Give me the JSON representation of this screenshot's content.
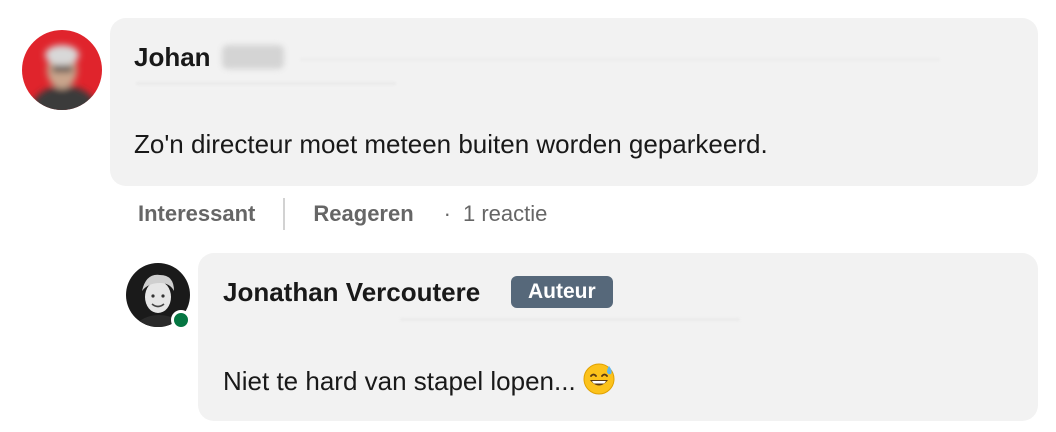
{
  "comment": {
    "author_first_name": "Johan",
    "text": "Zo'n directeur moet meteen buiten worden geparkeerd."
  },
  "actions": {
    "interesting_label": "Interessant",
    "reply_label": "Reageren",
    "separator_dot": "·",
    "reply_count": "1 reactie"
  },
  "reply": {
    "author_name": "Jonathan Vercoutere",
    "author_badge": "Auteur",
    "text": "Niet te hard van stapel lopen...",
    "emoji_icon": "grinning-face-with-sweat-icon",
    "online_status_color": "#057642"
  },
  "colors": {
    "bubble_bg": "#f2f2f2",
    "badge_bg": "#56687a",
    "avatar_bg": "#e0242c"
  }
}
